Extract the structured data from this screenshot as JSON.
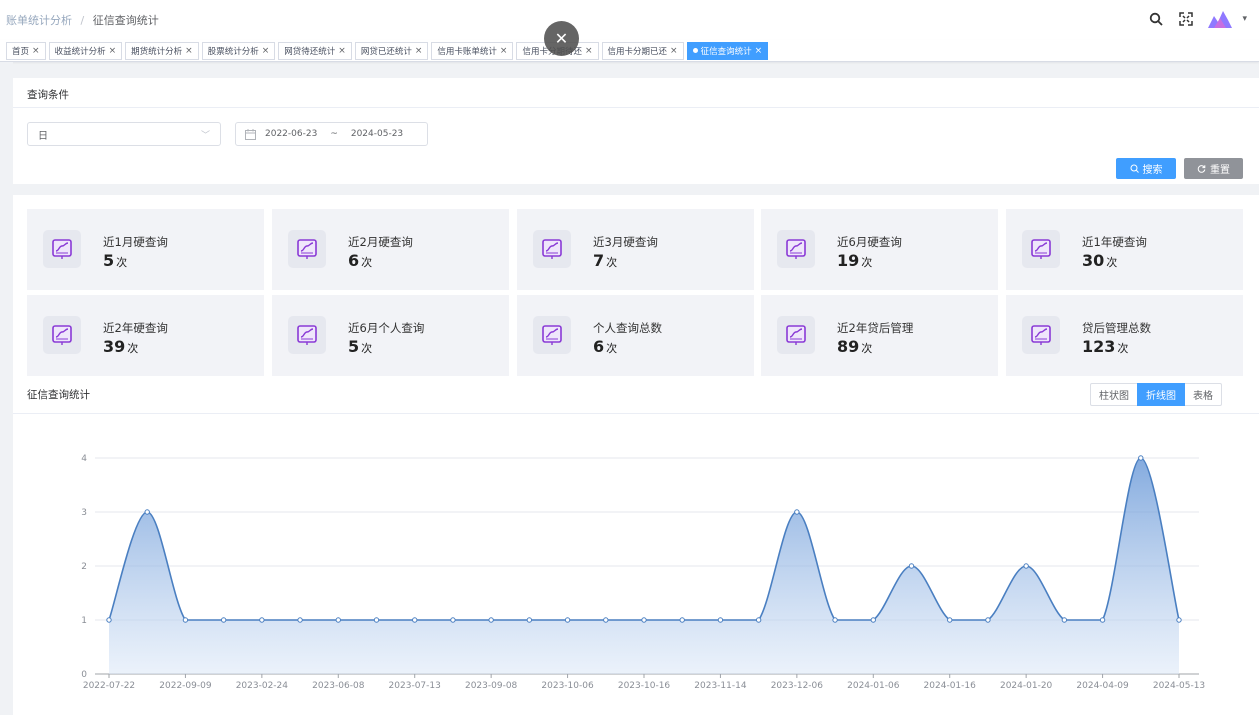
{
  "breadcrumb": {
    "parent": "账单统计分析",
    "separator": "/",
    "current": "征信查询统计"
  },
  "tags": [
    {
      "label": "首页",
      "active": false
    },
    {
      "label": "收益统计分析",
      "active": false
    },
    {
      "label": "期货统计分析",
      "active": false
    },
    {
      "label": "股票统计分析",
      "active": false
    },
    {
      "label": "网贷待还统计",
      "active": false
    },
    {
      "label": "网贷已还统计",
      "active": false
    },
    {
      "label": "信用卡账单统计",
      "active": false
    },
    {
      "label": "信用卡分期待还",
      "active": false
    },
    {
      "label": "信用卡分期已还",
      "active": false
    },
    {
      "label": "征信查询统计",
      "active": true
    }
  ],
  "query": {
    "section_title": "查询条件",
    "period_select": "日",
    "date_start": "2022-06-23",
    "date_separator": "~",
    "date_end": "2024-05-23",
    "search_label": "搜索",
    "reset_label": "重置"
  },
  "stats": [
    {
      "label": "近1月硬查询",
      "value": "5",
      "unit": "次"
    },
    {
      "label": "近2月硬查询",
      "value": "6",
      "unit": "次"
    },
    {
      "label": "近3月硬查询",
      "value": "7",
      "unit": "次"
    },
    {
      "label": "近6月硬查询",
      "value": "19",
      "unit": "次"
    },
    {
      "label": "近1年硬查询",
      "value": "30",
      "unit": "次"
    },
    {
      "label": "近2年硬查询",
      "value": "39",
      "unit": "次"
    },
    {
      "label": "近6月个人查询",
      "value": "5",
      "unit": "次"
    },
    {
      "label": "个人查询总数",
      "value": "6",
      "unit": "次"
    },
    {
      "label": "近2年贷后管理",
      "value": "89",
      "unit": "次"
    },
    {
      "label": "贷后管理总数",
      "value": "123",
      "unit": "次"
    }
  ],
  "chart_section": {
    "title": "征信查询统计",
    "view_buttons": [
      {
        "label": "柱状图",
        "active": false
      },
      {
        "label": "折线图",
        "active": true
      },
      {
        "label": "表格",
        "active": false
      }
    ]
  },
  "colors": {
    "accent": "#409eff",
    "line": "#4a7fc1",
    "reset": "#909399"
  },
  "chart_data": {
    "type": "area",
    "smooth": true,
    "ylim": [
      0,
      4
    ],
    "y_ticks": [
      0,
      1,
      2,
      3,
      4
    ],
    "x_tick_labels": [
      "2022-07-22",
      "2022-09-09",
      "2023-02-24",
      "2023-06-08",
      "2023-07-13",
      "2023-09-08",
      "2023-10-06",
      "2023-10-16",
      "2023-11-14",
      "2023-12-06",
      "2024-01-06",
      "2024-01-16",
      "2024-01-20",
      "2024-04-09",
      "2024-05-13"
    ],
    "values": [
      1,
      3,
      1,
      1,
      1,
      1,
      1,
      1,
      1,
      1,
      1,
      1,
      1,
      1,
      1,
      1,
      1,
      1,
      3,
      1,
      1,
      2,
      1,
      1,
      2,
      1,
      1,
      4,
      1
    ],
    "grid": true,
    "legend": "none"
  }
}
